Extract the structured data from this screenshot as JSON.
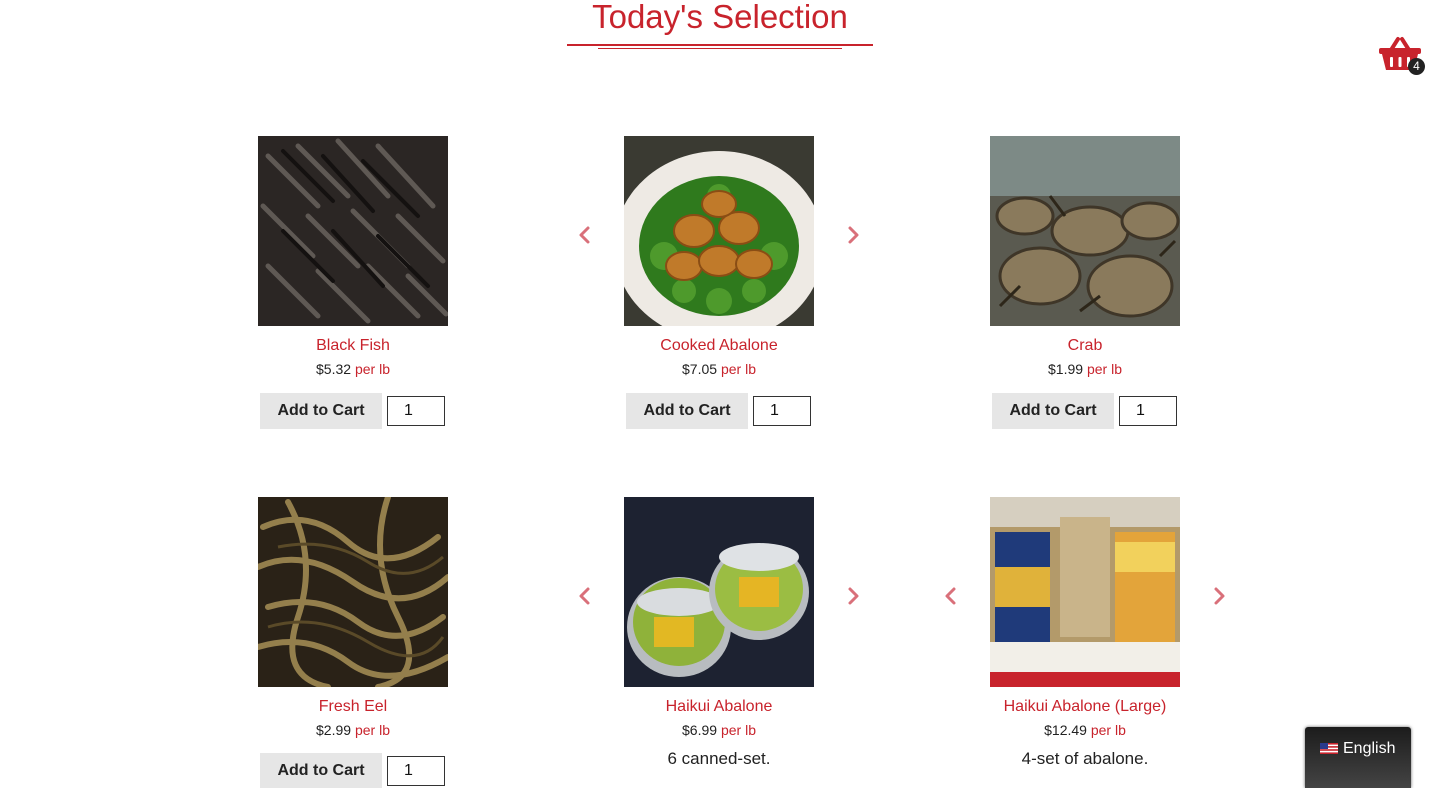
{
  "header": {
    "title": "Today's Selection",
    "cart_count": "4"
  },
  "products": [
    {
      "name": "Black Fish",
      "price": "$5.32",
      "unit": "per lb",
      "add_label": "Add to Cart",
      "qty": "1"
    },
    {
      "name": "Cooked Abalone",
      "price": "$7.05",
      "unit": "per lb",
      "add_label": "Add to Cart",
      "qty": "1"
    },
    {
      "name": "Crab",
      "price": "$1.99",
      "unit": "per lb",
      "add_label": "Add to Cart",
      "qty": "1"
    },
    {
      "name": "Fresh Eel",
      "price": "$2.99",
      "unit": "per lb",
      "add_label": "Add to Cart",
      "qty": "1"
    },
    {
      "name": "Haikui Abalone",
      "price": "$6.99",
      "unit": "per lb",
      "description": "6 canned-set."
    },
    {
      "name": "Haikui Abalone (Large)",
      "price": "$12.49",
      "unit": "per lb",
      "description": "4-set of abalone."
    }
  ],
  "language": {
    "label": "English",
    "flag_icon": "us-flag-icon"
  },
  "colors": {
    "accent": "#c8232c",
    "button_bg": "#e6e6e6",
    "arrow": "#d9707a"
  }
}
